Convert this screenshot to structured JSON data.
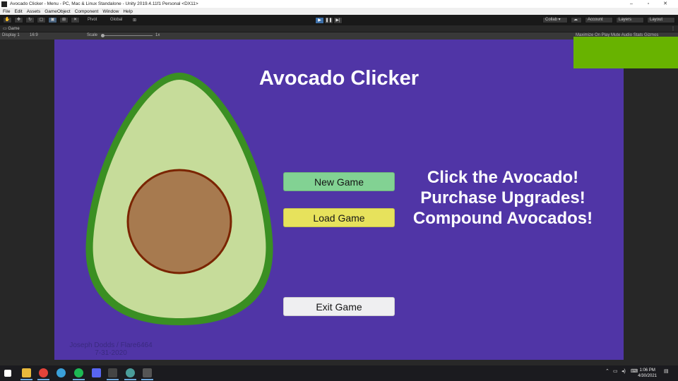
{
  "window": {
    "title": "Avocado Clicker - Menu - PC, Mac & Linux Standalone - Unity 2019.4.11f1 Personal <DX11>",
    "minimize": "–",
    "maximize": "▫",
    "close": "✕"
  },
  "menu": [
    "File",
    "Edit",
    "Assets",
    "GameObject",
    "Component",
    "Window",
    "Help"
  ],
  "toolbar": {
    "pivot": "Pivot",
    "global": "Global",
    "collab": "Collab ▾",
    "account": "Account",
    "layers": "Layers",
    "layout": "Layout",
    "play": "▶",
    "pause": "❚❚",
    "step": "▶|"
  },
  "game_tab": {
    "label": "Game",
    "display": "Display 1",
    "aspect": "16:9",
    "scale_label": "Scale",
    "scale_value": "1x",
    "right_options": "Maximize On Play   Mute Audio   Stats   Gizmos"
  },
  "game": {
    "title": "Avocado Clicker",
    "buttons": {
      "new_game": "New Game",
      "load_game": "Load Game",
      "exit_game": "Exit Game"
    },
    "tagline": [
      "Click the Avocado!",
      "Purchase Upgrades!",
      "Compound Avocados!"
    ],
    "credit_line1": "Joseph Dodds / Flare6464",
    "credit_line2": "7-31-2020"
  },
  "colors": {
    "game_bg": "#5035a6",
    "avocado_skin": "#3a8f22",
    "avocado_flesh": "#c6dc9a",
    "avocado_pit": "#a77a4f",
    "avocado_pit_outline": "#7a2400",
    "new_game_btn": "#82d293",
    "load_game_btn": "#e7e25c",
    "exit_game_btn": "#efeff1"
  },
  "taskbar": {
    "time": "1:06 PM",
    "date": "4/30/2021"
  }
}
